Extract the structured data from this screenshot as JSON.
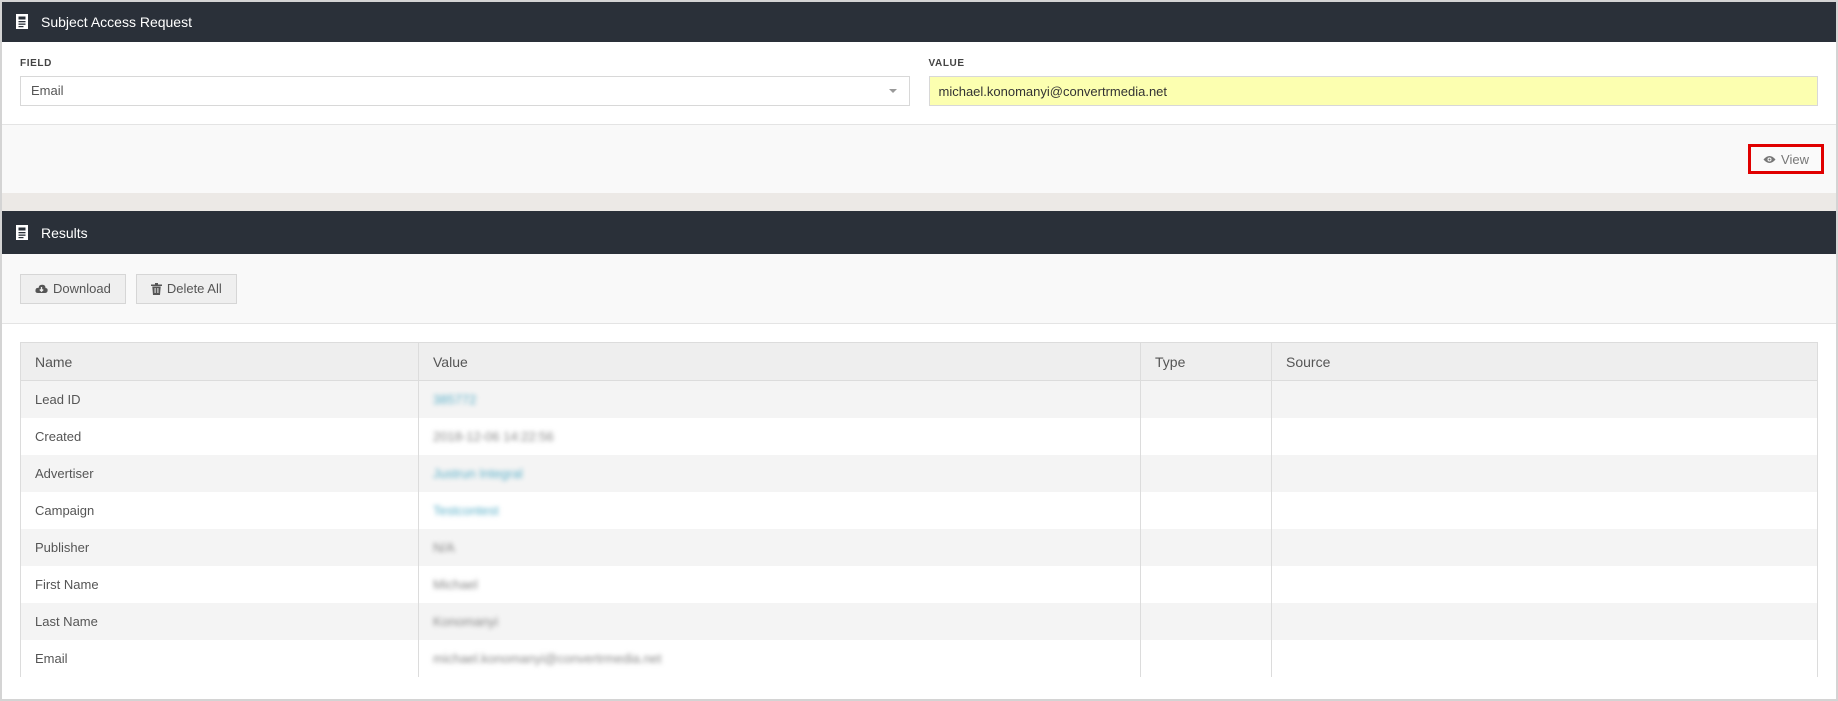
{
  "sar": {
    "title": "Subject Access Request",
    "field_label": "FIELD",
    "field_value": "Email",
    "value_label": "VALUE",
    "value_value": "michael.konomanyi@convertrmedia.net",
    "view_label": "View"
  },
  "results": {
    "title": "Results",
    "download_label": "Download",
    "delete_label": "Delete All",
    "columns": [
      "Name",
      "Value",
      "Type",
      "Source"
    ],
    "rows": [
      {
        "name": "Lead ID",
        "value": "385772",
        "link": true
      },
      {
        "name": "Created",
        "value": "2018-12-06 14:22:56",
        "link": false
      },
      {
        "name": "Advertiser",
        "value": "Justrun Integral",
        "link": true
      },
      {
        "name": "Campaign",
        "value": "Testcontest",
        "link": true
      },
      {
        "name": "Publisher",
        "value": "N/A",
        "link": false
      },
      {
        "name": "First Name",
        "value": "Michael",
        "link": false
      },
      {
        "name": "Last Name",
        "value": "Konomanyi",
        "link": false
      },
      {
        "name": "Email",
        "value": "michael.konomanyi@convertrmedia.net",
        "link": false
      }
    ]
  },
  "colors": {
    "header_bg": "#2a3039",
    "highlight_input": "#fcffb0",
    "annotation_border": "#e00000",
    "link": "#5bb0c9"
  }
}
